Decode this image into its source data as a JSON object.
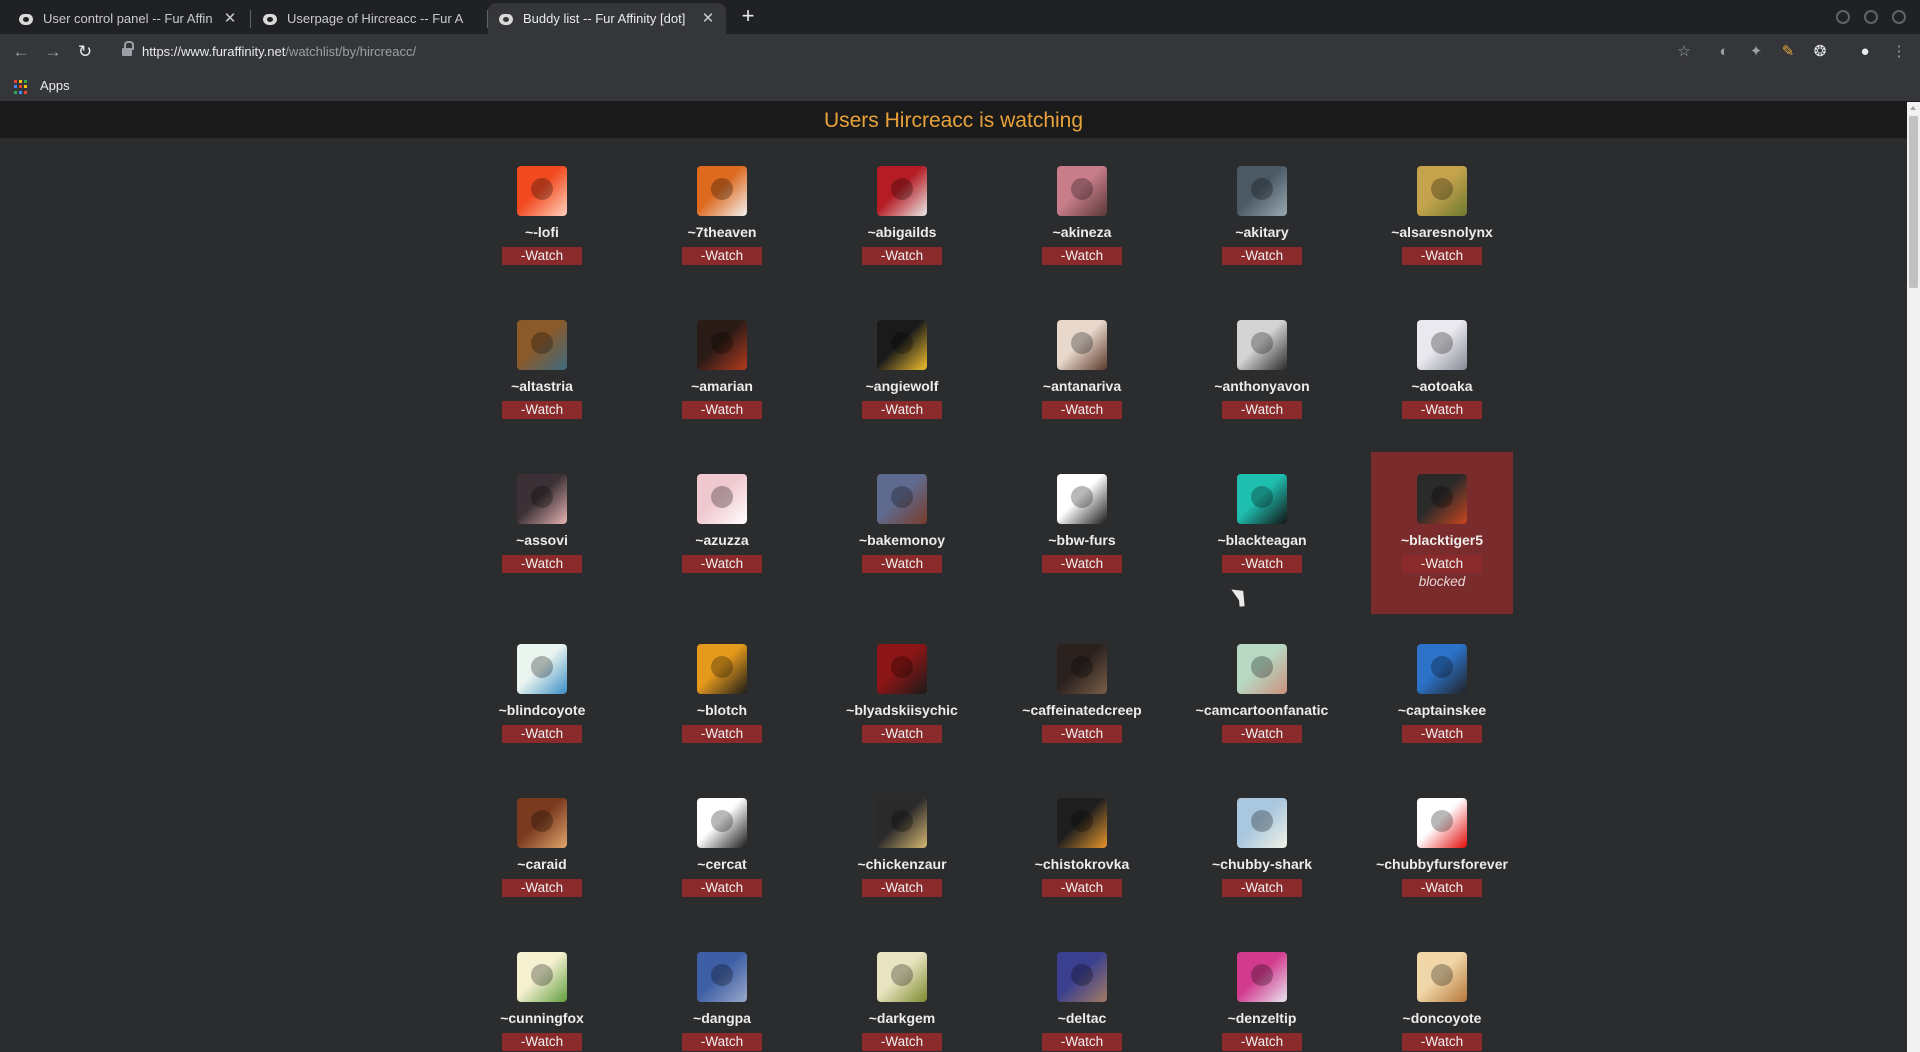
{
  "browser": {
    "tabs": [
      {
        "title": "User control panel -- Fur Affin",
        "active": false
      },
      {
        "title": "Userpage of Hircreacc -- Fur A",
        "active": false
      },
      {
        "title": "Buddy list -- Fur Affinity [dot]",
        "active": true
      }
    ],
    "url_host": "https://www.furaffinity.net",
    "url_path": "/watchlist/by/hircreacc/",
    "bookmarks": {
      "apps_label": "Apps"
    }
  },
  "page": {
    "title": "Users Hircreacc is watching",
    "watch_label": "-Watch",
    "blocked_label": "blocked"
  },
  "users": [
    {
      "name": "~-lofi",
      "colors": [
        "#f24a20",
        "#ffd2bd"
      ]
    },
    {
      "name": "~7theaven",
      "colors": [
        "#dd6a1e",
        "#f2f2f2"
      ]
    },
    {
      "name": "~abigailds",
      "colors": [
        "#b51c24",
        "#e9e9e9"
      ]
    },
    {
      "name": "~akineza",
      "colors": [
        "#c77d8a",
        "#5a3838"
      ]
    },
    {
      "name": "~akitary",
      "colors": [
        "#4a5964",
        "#9aaab3"
      ]
    },
    {
      "name": "~alsaresnolynx",
      "colors": [
        "#c5a34c",
        "#6d7b32"
      ]
    },
    {
      "name": "~altastria",
      "colors": [
        "#8a5a2b",
        "#3d6a80"
      ]
    },
    {
      "name": "~amarian",
      "colors": [
        "#2a1b16",
        "#b53a1e"
      ]
    },
    {
      "name": "~angiewolf",
      "colors": [
        "#1a1a1a",
        "#f2c12e"
      ]
    },
    {
      "name": "~antanariva",
      "colors": [
        "#e8d8cc",
        "#5b3a2c"
      ]
    },
    {
      "name": "~anthonyavon",
      "colors": [
        "#d4d4d4",
        "#2a2a2a"
      ]
    },
    {
      "name": "~aotoaka",
      "colors": [
        "#e9e9ef",
        "#8a8a96"
      ]
    },
    {
      "name": "~assovi",
      "colors": [
        "#3a3035",
        "#e7b3b3"
      ]
    },
    {
      "name": "~azuzza",
      "colors": [
        "#f0c8cf",
        "#ffffff"
      ]
    },
    {
      "name": "~bakemonoy",
      "colors": [
        "#5e6b8f",
        "#7a3b2b"
      ]
    },
    {
      "name": "~bbw-furs",
      "colors": [
        "#ffffff",
        "#1a1a1a"
      ]
    },
    {
      "name": "~blackteagan",
      "colors": [
        "#1fbfb0",
        "#121212"
      ]
    },
    {
      "name": "~blacktiger5",
      "colors": [
        "#2a2a2a",
        "#c7461d"
      ],
      "blocked": true
    },
    {
      "name": "~blindcoyote",
      "colors": [
        "#eaf5f0",
        "#3a8ec4"
      ]
    },
    {
      "name": "~blotch",
      "colors": [
        "#e59a1c",
        "#1a1a1a"
      ]
    },
    {
      "name": "~blyadskiisychic",
      "colors": [
        "#8c1515",
        "#1b1b1b"
      ]
    },
    {
      "name": "~caffeinatedcreep",
      "colors": [
        "#2b2220",
        "#7a5e46"
      ]
    },
    {
      "name": "~camcartoonfanatic",
      "colors": [
        "#b8d8c4",
        "#c9907a"
      ]
    },
    {
      "name": "~captainskee",
      "colors": [
        "#2c72c9",
        "#222222"
      ]
    },
    {
      "name": "~caraid",
      "colors": [
        "#7a3a1f",
        "#e1a56a"
      ]
    },
    {
      "name": "~cercat",
      "colors": [
        "#ffffff",
        "#1a1a1a"
      ]
    },
    {
      "name": "~chickenzaur",
      "colors": [
        "#2a2a2a",
        "#d8b873"
      ]
    },
    {
      "name": "~chistokrovka",
      "colors": [
        "#1e1e1e",
        "#e7962b"
      ]
    },
    {
      "name": "~chubby-shark",
      "colors": [
        "#a9c7de",
        "#f2f2e6"
      ]
    },
    {
      "name": "~chubbyfursforever",
      "colors": [
        "#ffffff",
        "#e30b0b"
      ]
    },
    {
      "name": "~cunningfox",
      "colors": [
        "#f4f0d0",
        "#5f9d3e"
      ]
    },
    {
      "name": "~dangpa",
      "colors": [
        "#3e5fa5",
        "#9aa9c9"
      ]
    },
    {
      "name": "~darkgem",
      "colors": [
        "#e8e3c0",
        "#7c8a2f"
      ]
    },
    {
      "name": "~deltac",
      "colors": [
        "#3b3f8f",
        "#a37c61"
      ]
    },
    {
      "name": "~denzeltip",
      "colors": [
        "#d23a8e",
        "#e6e6ee"
      ]
    },
    {
      "name": "~doncoyote",
      "colors": [
        "#f0d6a8",
        "#b5783c"
      ]
    }
  ]
}
